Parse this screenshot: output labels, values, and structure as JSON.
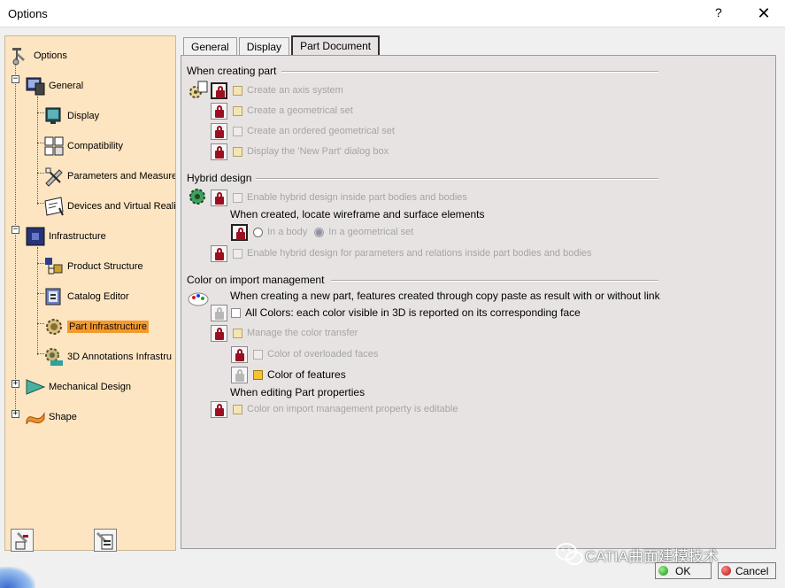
{
  "window": {
    "title": "Options",
    "help": "?",
    "close": "✕"
  },
  "tree": {
    "items": [
      {
        "label": "Options"
      },
      {
        "label": "General"
      },
      {
        "label": "Display"
      },
      {
        "label": "Compatibility"
      },
      {
        "label": "Parameters and Measure"
      },
      {
        "label": "Devices and Virtual Reali"
      },
      {
        "label": "Infrastructure"
      },
      {
        "label": "Product Structure"
      },
      {
        "label": "Catalog Editor"
      },
      {
        "label": "Part Infrastructure"
      },
      {
        "label": "3D Annotations Infrastru"
      },
      {
        "label": "Mechanical Design"
      },
      {
        "label": "Shape"
      }
    ],
    "selected": "Part Infrastructure"
  },
  "tabs": [
    {
      "label": "General"
    },
    {
      "label": "Display"
    },
    {
      "label": "Part Document"
    }
  ],
  "creating_part": {
    "title": "When creating part",
    "options": [
      {
        "label": "Create an axis system",
        "checked": true
      },
      {
        "label": "Create a geometrical set",
        "checked": true
      },
      {
        "label": "Create an ordered geometrical set",
        "checked": false
      },
      {
        "label": "Display the 'New Part' dialog box",
        "checked": true
      }
    ]
  },
  "hybrid": {
    "title": "Hybrid design",
    "enable_bodies": "Enable hybrid design inside part bodies and bodies",
    "locate_title": "When created, locate wireframe and surface elements",
    "in_body": "In a body",
    "in_geoset": "In a geometrical set",
    "enable_params": "Enable hybrid design for parameters and relations inside part bodies and bodies"
  },
  "color_import": {
    "title": "Color on import management",
    "copy_paste_title": "When creating a new part, features created through copy paste as result with or without link",
    "all_colors": "All Colors: each color visible in 3D is reported on its corresponding face",
    "manage_transfer": "Manage the color transfer",
    "overloaded": "Color of overloaded faces",
    "features": "Color of features",
    "editing_title": "When editing Part properties",
    "editable": "Color on import management property is editable"
  },
  "buttons": {
    "ok": "OK",
    "cancel": "Cancel"
  },
  "watermark": "CATIA曲面建模技术"
}
